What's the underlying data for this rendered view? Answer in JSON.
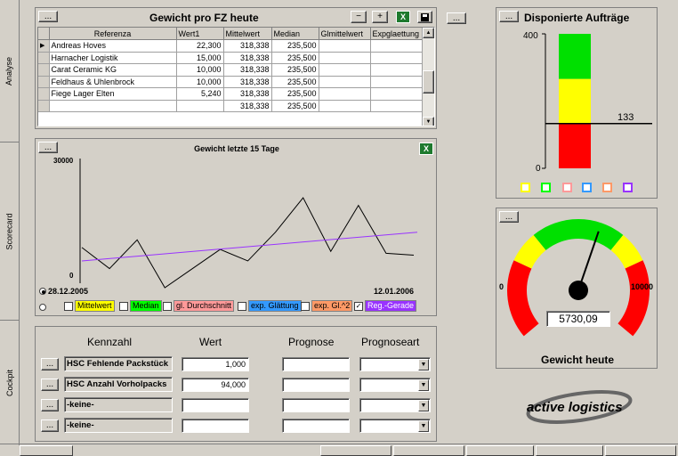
{
  "sidebar": {
    "tabs": [
      {
        "label": "Analyse"
      },
      {
        "label": "Scorecard"
      },
      {
        "label": "Cockpit"
      }
    ]
  },
  "common": {
    "ellipsis": "...",
    "minus": "−",
    "plus": "+",
    "excel": "X",
    "combo_arrow": "▼"
  },
  "weight_table": {
    "title": "Gewicht pro FZ heute",
    "columns": [
      "Referenza",
      "Wert1",
      "Mittelwert",
      "Median",
      "Glmittelwert",
      "Expglaettung"
    ],
    "rows": [
      [
        "Andreas Hoves",
        "22,300",
        "318,338",
        "235,500",
        "",
        ""
      ],
      [
        "Harnacher Logistik",
        "15,000",
        "318,338",
        "235,500",
        "",
        ""
      ],
      [
        "Carat Ceramic KG",
        "10,000",
        "318,338",
        "235,500",
        "",
        ""
      ],
      [
        "Feldhaus & Uhlenbrock",
        "10,000",
        "318,338",
        "235,500",
        "",
        ""
      ],
      [
        "Fiege Lager Elten",
        "5,240",
        "318,338",
        "235,500",
        "",
        ""
      ],
      [
        "",
        "",
        "318,338",
        "235,500",
        "",
        ""
      ]
    ],
    "selected_marker": "▶"
  },
  "line_chart_panel": {
    "legend": [
      {
        "label": "Mittelwert",
        "color": "#ffff00",
        "checked": false
      },
      {
        "label": "Median",
        "color": "#00ff00",
        "checked": false
      },
      {
        "label": "gl. Durchschnitt",
        "color": "#ff9999",
        "checked": false
      },
      {
        "label": "exp. Glättung",
        "color": "#3399ff",
        "checked": false
      },
      {
        "label": "exp. Gl.^2",
        "color": "#ff9966",
        "checked": false
      },
      {
        "label": "Reg.-Gerade",
        "color": "#9933ff",
        "checked": true
      }
    ],
    "check_mark": "✓"
  },
  "chart_data": [
    {
      "type": "line",
      "title": "Gewicht letzte 15 Tage",
      "xlabel": "",
      "ylabel": "",
      "ylim": [
        0,
        30000
      ],
      "y_ticks": [
        "30000",
        "0"
      ],
      "x_start_label": "28.12.2005",
      "x_end_label": "12.01.2006",
      "grid": false,
      "series": [
        {
          "values": [
            7000,
            1500,
            9000,
            -3500,
            1500,
            6500,
            3500,
            11000,
            20000,
            6000,
            18000,
            5500,
            5000
          ],
          "color": "#000000"
        },
        {
          "values": [
            3500,
            11000
          ],
          "color": "#9933ff",
          "trend": true
        }
      ]
    },
    {
      "type": "bar",
      "title": "Disponierte Aufträge",
      "ylim": [
        0,
        400
      ],
      "y_ticks": [
        "400",
        "0"
      ],
      "value": 133,
      "value_label": "133",
      "bands": [
        {
          "from": 0,
          "to": 133,
          "color": "#ff0000"
        },
        {
          "from": 133,
          "to": 266,
          "color": "#ffff00"
        },
        {
          "from": 266,
          "to": 400,
          "color": "#00e000"
        }
      ],
      "color_squares": [
        "#ffff00",
        "#00ff00",
        "#ff9999",
        "#3399ff",
        "#ff9966",
        "#9933ff"
      ]
    },
    {
      "type": "gauge",
      "title": "Gewicht heute",
      "min": 0,
      "max": 10000,
      "min_label": "0",
      "max_label": "10000",
      "value": 5730.09,
      "value_label": "5730,09",
      "bands": [
        {
          "from": 0,
          "to": 2500,
          "color": "#ff0000"
        },
        {
          "from": 2500,
          "to": 3500,
          "color": "#ffff00"
        },
        {
          "from": 3500,
          "to": 6500,
          "color": "#00e000"
        },
        {
          "from": 6500,
          "to": 7500,
          "color": "#ffff00"
        },
        {
          "from": 7500,
          "to": 10000,
          "color": "#ff0000"
        }
      ]
    }
  ],
  "kpi_panel": {
    "headers": {
      "kennzahl": "Kennzahl",
      "wert": "Wert",
      "prognose": "Prognose",
      "prognoseart": "Prognoseart"
    },
    "rows": [
      {
        "name": "HSC Fehlende Packstück",
        "value": "1,000"
      },
      {
        "name": "HSC Anzahl Vorholpacks",
        "value": "94,000"
      },
      {
        "name": "-keine-",
        "value": ""
      },
      {
        "name": "-keine-",
        "value": ""
      }
    ]
  },
  "brand": {
    "logo_text": "active logistics"
  }
}
